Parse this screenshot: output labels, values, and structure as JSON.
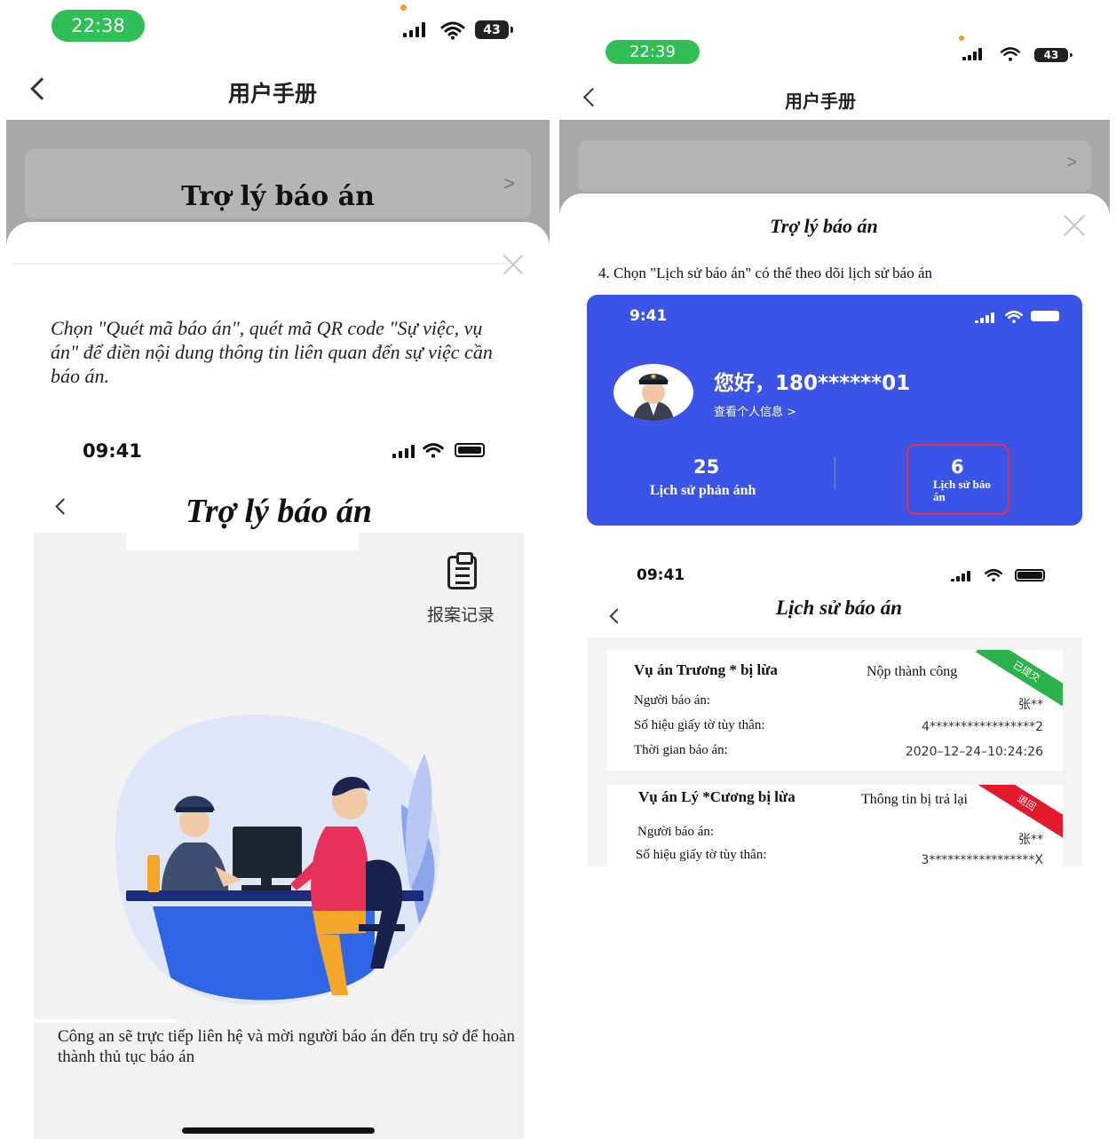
{
  "left": {
    "status_time": "22:38",
    "battery": "43",
    "nav_title": "用户手册",
    "card_title": "Trợ lý báo án",
    "card_chevron": ">",
    "intro": "Chọn \"Quét mã báo án\", quét mã QR code \"Sự việc, vụ án\" để điền nội dung thông tin liên quan đến sự việc cần báo án.",
    "inner": {
      "time": "09:41",
      "title": "Trợ lý báo án",
      "report_label": "报案记录",
      "footer": "Công an sẽ trực tiếp liên hệ và mời người báo án đến trụ sở  để hoàn thành thủ tục báo án"
    }
  },
  "right": {
    "status_time": "22:39",
    "battery": "43",
    "nav_title": "用户手册",
    "card_chevron": ">",
    "sheet_title": "Trợ lý báo án",
    "step": "4. Chọn \"Lịch sử báo án\" có thể theo dõi lịch sử báo án",
    "profile": {
      "time": "9:41",
      "greeting": "您好，180******01",
      "view_info": "查看个人信息 >",
      "stat1_value": "25",
      "stat1_label": "Lịch sử phản ánh",
      "stat2_value": "6",
      "stat2_label": "Lịch sử báo án"
    },
    "history": {
      "time": "09:41",
      "title": "Lịch sử báo án",
      "cases": [
        {
          "title": "Vụ án Trương * bị lừa",
          "status": "Nộp thành công",
          "ribbon": "已提交",
          "ribbon_color": "#2bb24c",
          "reporter_label": "Người báo án:",
          "reporter_value": "张**",
          "id_label": "Số hiệu giấy tờ tùy thân:",
          "id_value": "4*****************2",
          "time_label": "Thời gian báo án:",
          "time_value": "2020–12–24–10:24:26"
        },
        {
          "title": "Vụ án Lý *Cương bị lừa",
          "status": "Thông tin bị trả lại",
          "ribbon": "退回",
          "ribbon_color": "#e5192c",
          "reporter_label": "Người báo án:",
          "reporter_value": "张**",
          "id_label": "Số hiệu giấy tờ tùy thân:",
          "id_value": "3*****************X"
        }
      ]
    }
  }
}
